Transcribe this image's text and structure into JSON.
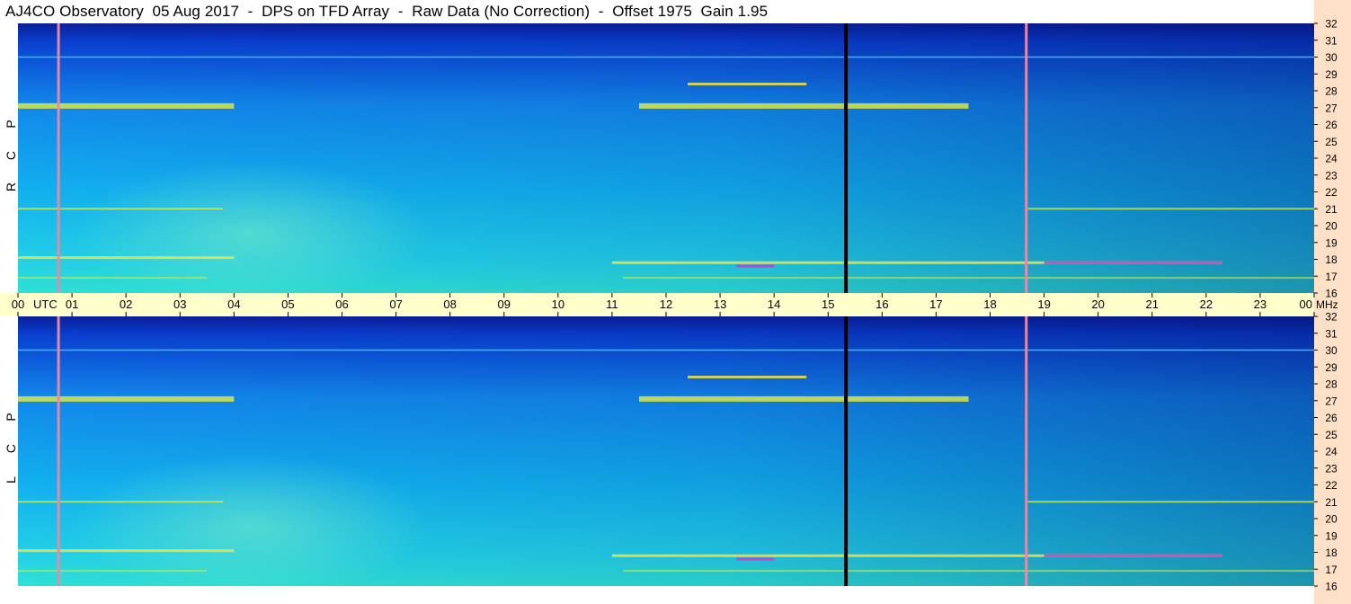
{
  "title": "AJ4CO Observatory  05 Aug 2017  -  DPS on TFD Array  -  Raw Data (No Correction)  -  Offset 1975  Gain 1.95",
  "panels": [
    {
      "id": "rcp",
      "label_letters": [
        "P",
        "C",
        "R"
      ]
    },
    {
      "id": "lcp",
      "label_letters": [
        "P",
        "C",
        "L"
      ]
    }
  ],
  "colors": {
    "time_axis_band": "#ffffcc",
    "freq_axis_band": "#fde0c6",
    "background_high": "#0a1f9a",
    "background_mid": "#1180e6",
    "background_low": "#27dde0",
    "marker_line": "#000000",
    "interference_line": "#e48aa8"
  },
  "chart_data": {
    "type": "heatmap",
    "title": "AJ4CO Observatory  05 Aug 2017  -  DPS on TFD Array  -  Raw Data (No Correction)  -  Offset 1975  Gain 1.95",
    "x_ticks": [
      "00",
      "01",
      "02",
      "03",
      "04",
      "05",
      "06",
      "07",
      "08",
      "09",
      "10",
      "11",
      "12",
      "13",
      "14",
      "15",
      "16",
      "17",
      "18",
      "19",
      "20",
      "21",
      "22",
      "23",
      "00"
    ],
    "x_unit": "UTC",
    "xlim": [
      0,
      24
    ],
    "y_ticks": [
      32,
      31,
      30,
      29,
      28,
      27,
      26,
      25,
      24,
      23,
      22,
      21,
      20,
      19,
      18,
      17,
      16
    ],
    "y_unit": "MHz",
    "ylim": [
      16,
      32
    ],
    "grid": false,
    "black_marker_utc": 15.33,
    "interference_lines_utc": [
      0.75,
      18.67
    ],
    "bands": [
      {
        "mhz": 27.1,
        "segments": [
          [
            0.0,
            4.0
          ],
          [
            11.5,
            17.6
          ]
        ]
      },
      {
        "mhz": 28.4,
        "segments": [
          [
            12.4,
            14.6
          ]
        ]
      },
      {
        "mhz": 30.0,
        "segments": [
          [
            0.0,
            24.0
          ]
        ]
      },
      {
        "mhz": 21.0,
        "segments": [
          [
            0.0,
            3.8
          ],
          [
            18.7,
            24.0
          ]
        ]
      },
      {
        "mhz": 18.1,
        "segments": [
          [
            0.0,
            4.0
          ]
        ]
      },
      {
        "mhz": 17.8,
        "segments": [
          [
            11.0,
            22.3
          ]
        ]
      },
      {
        "mhz": 16.9,
        "segments": [
          [
            0.0,
            3.5
          ],
          [
            11.2,
            24.0
          ]
        ]
      }
    ]
  }
}
